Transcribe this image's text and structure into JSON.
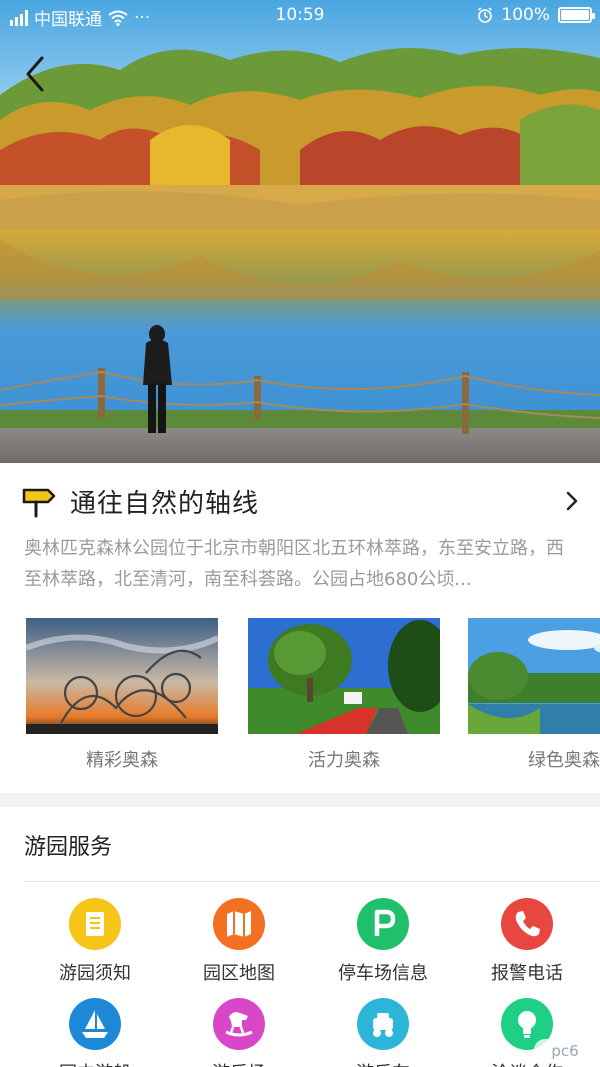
{
  "status_bar": {
    "carrier": "中国联通",
    "dots": "···",
    "time": "10:59",
    "battery_text": "100%",
    "battery_level": 1.0
  },
  "hero": {
    "back_icon": "chevron-left-icon",
    "image": "autumn-lake-park-photo"
  },
  "intro": {
    "signpost_icon": "signpost-icon",
    "title": "通往自然的轴线",
    "arrow_icon": "chevron-right-icon",
    "description": "奥林匹克森林公园位于北京市朝阳区北五环林萃路，东至安立路，西至林萃路，北至清河，南至科荟路。公园占地680公顷..."
  },
  "gallery": [
    {
      "label": "精彩奥森",
      "image": "sculpture-sunset-photo"
    },
    {
      "label": "活力奥森",
      "image": "tree-path-photo"
    },
    {
      "label": "绿色奥森",
      "image": "lake-green-photo"
    }
  ],
  "services": {
    "title": "游园服务",
    "items": [
      {
        "label": "游园须知",
        "icon": "notice-list-icon",
        "color": "#f5c518"
      },
      {
        "label": "园区地图",
        "icon": "map-icon",
        "color": "#f36f21"
      },
      {
        "label": "停车场信息",
        "icon": "parking-icon",
        "color": "#1fbf6b"
      },
      {
        "label": "报警电话",
        "icon": "phone-icon",
        "color": "#e8473f"
      },
      {
        "label": "园中游船",
        "icon": "sailboat-icon",
        "color": "#1e88d8"
      },
      {
        "label": "游乐场",
        "icon": "rocking-horse-icon",
        "color": "#d946c8"
      },
      {
        "label": "游乐车",
        "icon": "scooter-icon",
        "color": "#2bb5d8"
      },
      {
        "label": "洽谈合作",
        "icon": "lightbulb-icon",
        "color": "#1fcf84"
      }
    ]
  },
  "watermark": "pc6"
}
